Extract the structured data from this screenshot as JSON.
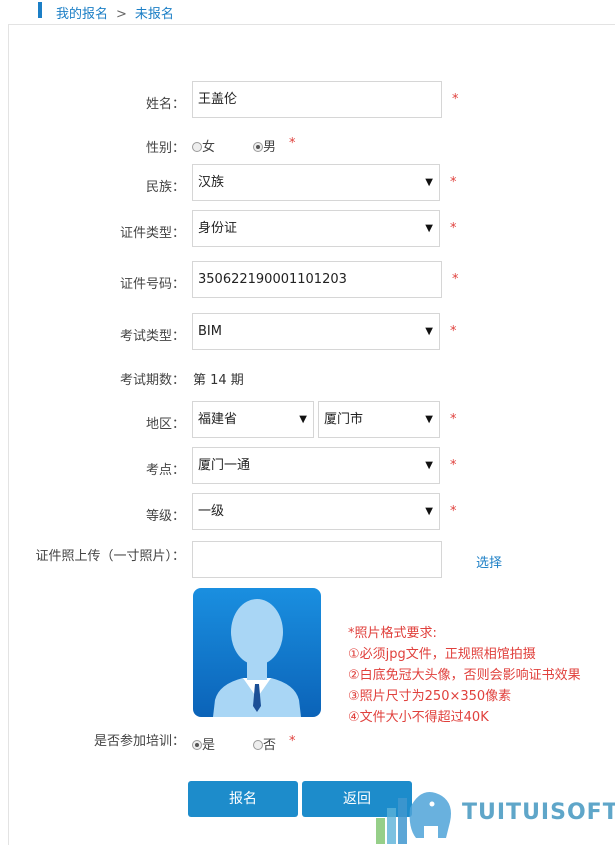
{
  "breadcrumb": {
    "parent": "我的报名",
    "sep": ">",
    "current": "未报名"
  },
  "form": {
    "name": {
      "label": "姓名：",
      "value": "王盖伦"
    },
    "gender": {
      "label": "性别：",
      "opt_female": "女",
      "opt_male": "男",
      "selected": "男"
    },
    "ethnicity": {
      "label": "民族：",
      "value": "汉族"
    },
    "id_type": {
      "label": "证件类型：",
      "value": "身份证"
    },
    "id_number": {
      "label": "证件号码：",
      "value": "350622190001101203"
    },
    "exam_type": {
      "label": "考试类型：",
      "value": "BIM"
    },
    "exam_period": {
      "label": "考试期数：",
      "value": "第 14 期"
    },
    "region": {
      "label": "地区：",
      "province": "福建省",
      "city": "厦门市"
    },
    "exam_site": {
      "label": "考点：",
      "value": "厦门一通"
    },
    "level": {
      "label": "等级：",
      "value": "一级"
    },
    "photo_upload": {
      "label": "证件照上传（一寸照片）：",
      "value": "",
      "select_link": "选择"
    },
    "photo_requirements": {
      "title": "*照片格式要求:",
      "items": [
        "①必须jpg文件，正规照相馆拍摄",
        "②白底免冠大头像，否则会影响证书效果",
        "③照片尺寸为250×350像素",
        "④文件大小不得超过40K"
      ]
    },
    "training": {
      "label": "是否参加培训：",
      "opt_yes": "是",
      "opt_no": "否",
      "selected": "是"
    },
    "required_mark": "*"
  },
  "buttons": {
    "submit": "报名",
    "back": "返回"
  },
  "watermark": {
    "text": "TUITUISOFT"
  },
  "colors": {
    "accent": "#1c7fc6",
    "button": "#1d8ccb",
    "required": "#e0413d"
  }
}
